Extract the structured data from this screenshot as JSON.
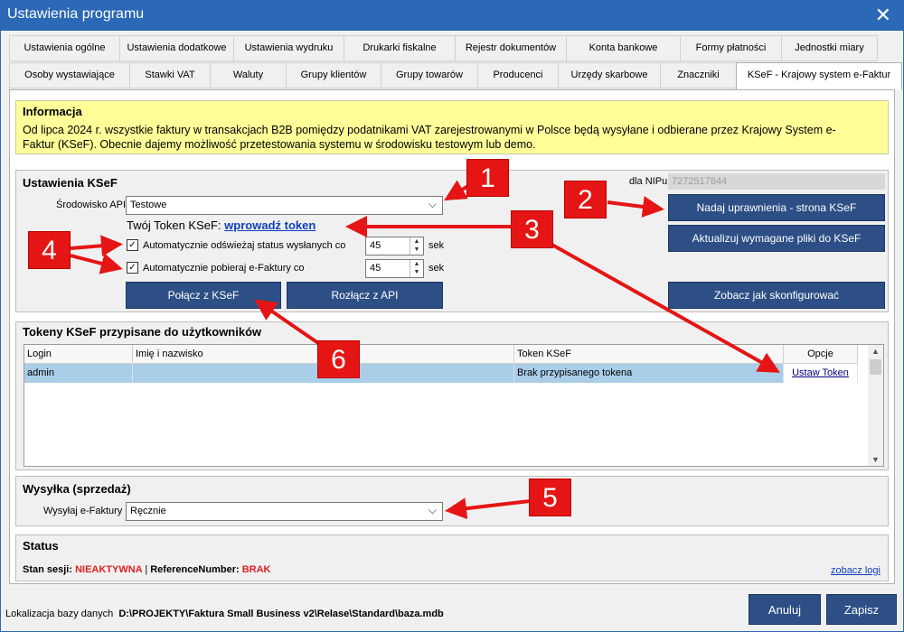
{
  "window": {
    "title": "Ustawienia programu"
  },
  "tabs_row1": [
    "Ustawienia ogólne",
    "Ustawienia dodatkowe",
    "Ustawienia wydruku",
    "Drukarki fiskalne",
    "Rejestr dokumentów",
    "Konta bankowe",
    "Formy płatności",
    "Jednostki miary"
  ],
  "tabs_row2": [
    "Osoby wystawiające",
    "Stawki VAT",
    "Waluty",
    "Grupy klientów",
    "Grupy towarów",
    "Producenci",
    "Urzędy skarbowe",
    "Znaczniki",
    "KSeF - Krajowy system e-Faktur"
  ],
  "info": {
    "heading": "Informacja",
    "text": "Od lipca 2024 r. wszystkie faktury w transakcjach B2B pomiędzy podatnikami VAT zarejestrowanymi w Polsce będą wysyłane i odbierane przez Krajowy System e-Faktur (KSeF). Obecnie dajemy możliwość przetestowania systemu w środowisku testowym lub demo."
  },
  "ksef": {
    "heading": "Ustawienia KSeF",
    "env_label": "Środowisko API",
    "env_value": "Testowe",
    "token_label": "Twój Token KSeF:",
    "token_link": "wprowadź token",
    "chk_status_label": "Automatycznie odświeżaj status wysłanych co",
    "chk_status_value": "45",
    "chk_fetch_label": "Automatycznie pobieraj e-Faktury co",
    "chk_fetch_value": "45",
    "unit": "sek",
    "connect_button": "Połącz z KSeF",
    "disconnect_button": "Rozłącz z API",
    "nip_label": "dla NIPu",
    "nip_value": "7272517844",
    "grant_button": "Nadaj uprawnienia - strona KSeF",
    "update_button": "Aktualizuj wymagane pliki do KSeF",
    "config_button": "Zobacz jak skonfigurować"
  },
  "tokens": {
    "heading": "Tokeny KSeF przypisane do użytkowników",
    "columns": [
      "Login",
      "Imię i nazwisko",
      "Token KSeF",
      "Opcje"
    ],
    "rows": [
      {
        "login": "admin",
        "name": "",
        "token": "Brak przypisanego tokena",
        "option": "Ustaw Token"
      }
    ]
  },
  "sending": {
    "heading": "Wysyłka (sprzedaż)",
    "label": "Wysyłaj e-Faktury",
    "value": "Ręcznie"
  },
  "status": {
    "heading": "Status",
    "session_label": "Stan sesji:",
    "session_value": "NIEAKTYWNA",
    "separator": "|",
    "ref_label": "ReferenceNumber:",
    "ref_value": "BRAK",
    "log_link": "zobacz logi"
  },
  "footer": {
    "db_label": "Lokalizacja bazy danych",
    "db_path": "D:\\PROJEKTY\\Faktura Small Business v2\\Relase\\Standard\\baza.mdb",
    "cancel_button": "Anuluj",
    "save_button": "Zapisz"
  },
  "markers": [
    "1",
    "2",
    "3",
    "4",
    "5",
    "6"
  ],
  "colors": {
    "titlebar": "#2b68b5",
    "button": "#2d4f86",
    "info_bg": "#fffe99",
    "marker": "#e51515",
    "selected_row": "#aacde8"
  }
}
